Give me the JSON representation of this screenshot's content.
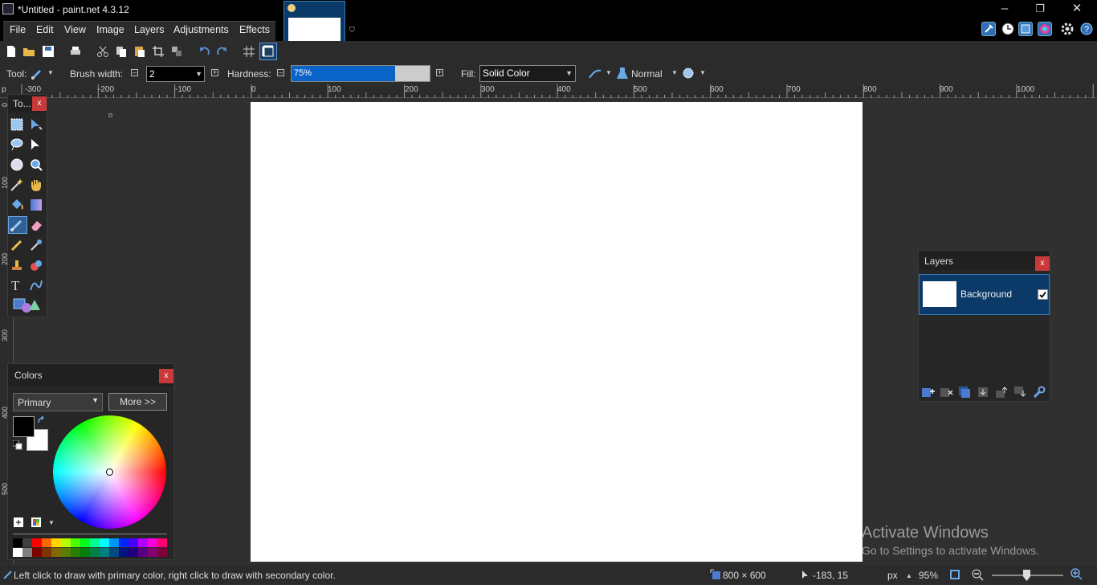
{
  "window": {
    "title": "*Untitled - paint.net 4.3.12",
    "controls": [
      "–",
      "❐",
      "✕"
    ]
  },
  "menu": [
    "File",
    "Edit",
    "View",
    "Image",
    "Layers",
    "Adjustments",
    "Effects"
  ],
  "toolbar": {
    "tool_label": "Tool:",
    "brush_width_label": "Brush width:",
    "brush_width_value": "2",
    "hardness_label": "Hardness:",
    "hardness_value": "75%",
    "hardness_fraction": 0.75,
    "fill_label": "Fill:",
    "fill_value": "Solid Color",
    "blend_mode": "Normal"
  },
  "ruler": {
    "ticks": [
      "-300",
      "-200",
      "-100",
      "0",
      "100",
      "200",
      "300",
      "400",
      "500",
      "600",
      "700",
      "800",
      "900",
      "1000"
    ],
    "left_ticks": [
      "0",
      "100",
      "200",
      "300",
      "400",
      "500"
    ]
  },
  "tools_panel": {
    "title": "To...",
    "close": "x"
  },
  "colors_panel": {
    "title": "Colors",
    "close": "x",
    "mode": "Primary",
    "more_button": "More >>",
    "primary_color": "#000000",
    "secondary_color": "#ffffff",
    "palette_row1": [
      "#000000",
      "#404040",
      "#ff0000",
      "#ff6a00",
      "#ffd800",
      "#b6ff00",
      "#4cff00",
      "#00ff21",
      "#00ff90",
      "#00ffff",
      "#0094ff",
      "#0026ff",
      "#4800ff",
      "#b200ff",
      "#ff00dc",
      "#ff006e"
    ],
    "palette_row2": [
      "#ffffff",
      "#808080",
      "#7f0000",
      "#7f3300",
      "#7f6a00",
      "#5b7f00",
      "#267f00",
      "#007f0e",
      "#007f46",
      "#007f7f",
      "#004a7f",
      "#00137f",
      "#21007f",
      "#57007f",
      "#7f006e",
      "#7f0037"
    ]
  },
  "layers_panel": {
    "title": "Layers",
    "close": "x",
    "layers": [
      {
        "name": "Background",
        "visible": true
      }
    ]
  },
  "status": {
    "hint": "Left click to draw with primary color, right click to draw with secondary color.",
    "image_size": "800 × 600",
    "cursor_pos": "-183, 15",
    "unit": "px",
    "zoom": "95%"
  },
  "watermark": {
    "line1": "Activate Windows",
    "line2": "Go to Settings to activate Windows."
  },
  "colors": {
    "accent": "#0b3a68",
    "selection": "#0a64c8",
    "close_red": "#c83a3a"
  }
}
